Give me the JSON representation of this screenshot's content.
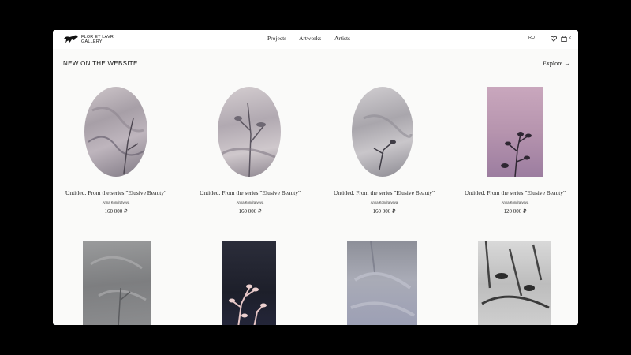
{
  "brand": {
    "line1": "FLOR ET LAVR",
    "line2": "GALLERY",
    "icon": "horse-logo-icon"
  },
  "nav": {
    "items": [
      "Projects",
      "Artworks",
      "Artists"
    ],
    "lang": "RU",
    "cart_count": "2"
  },
  "icons": {
    "wishlist": "heart-icon",
    "cart": "shopping-bag-icon",
    "explore_arrow": "arrow-right-icon"
  },
  "section": {
    "title": "NEW ON THE WEBSITE",
    "explore": "Explore →"
  },
  "artworks": [
    {
      "title": "Untitled. From the series \"Elusive Beauty\"",
      "artist": "Anna Kondratyeva",
      "price": "160 000 ₽"
    },
    {
      "title": "Untitled. From the series \"Elusive Beauty\"",
      "artist": "Anna Kondratyeva",
      "price": "160 000 ₽"
    },
    {
      "title": "Untitled. From the series \"Elusive Beauty\"",
      "artist": "Anna Kondratyeva",
      "price": "160 000 ₽"
    },
    {
      "title": "Untitled. From the series \"Elusive Beauty\"",
      "artist": "Anna Kondratyeva",
      "price": "120 000 ₽"
    }
  ],
  "colors": {
    "background": "#000000",
    "page": "#fafaf9",
    "text": "#222222"
  }
}
